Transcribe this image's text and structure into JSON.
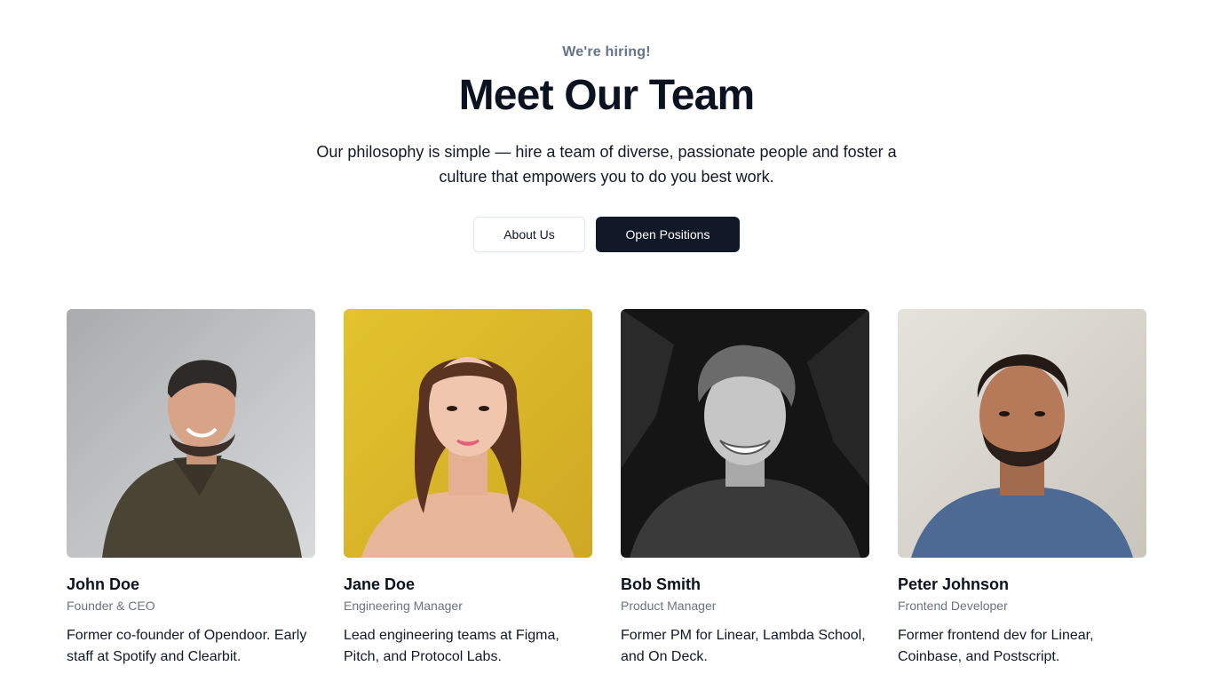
{
  "hero": {
    "eyebrow": "We're hiring!",
    "title": "Meet Our Team",
    "subtitle": "Our philosophy is simple — hire a team of diverse, passionate people and foster a culture that empowers you to do you best work.",
    "buttons": {
      "about": "About Us",
      "positions": "Open Positions"
    }
  },
  "team": [
    {
      "name": "John Doe",
      "role": "Founder & CEO",
      "bio": "Former co-founder of Opendoor. Early staff at Spotify and Clearbit.",
      "photo_bg": "#c9cbcd"
    },
    {
      "name": "Jane Doe",
      "role": "Engineering Manager",
      "bio": "Lead engineering teams at Figma, Pitch, and Protocol Labs.",
      "photo_bg": "#d9b92c"
    },
    {
      "name": "Bob Smith",
      "role": "Product Manager",
      "bio": "Former PM for Linear, Lambda School, and On Deck.",
      "photo_bg": "#1c1c1c"
    },
    {
      "name": "Peter Johnson",
      "role": "Frontend Developer",
      "bio": "Former frontend dev for Linear, Coinbase, and Postscript.",
      "photo_bg": "#d9d6d0"
    }
  ],
  "colors": {
    "primary_button": "#111827",
    "muted_text": "#6b7280"
  }
}
